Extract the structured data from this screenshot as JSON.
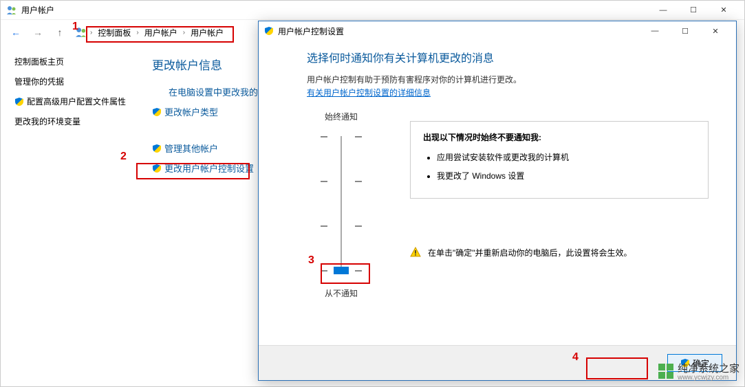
{
  "main_window": {
    "title": "用户帐户",
    "controls": {
      "min": "—",
      "max": "☐",
      "close": "✕"
    },
    "nav": {
      "back": "←",
      "forward": "→",
      "up": "↑"
    },
    "breadcrumb": [
      "控制面板",
      "用户帐户",
      "用户帐户"
    ],
    "sidebar": {
      "home": "控制面板主页",
      "creds": "管理你的凭据",
      "advanced": "配置高级用户配置文件属性",
      "env": "更改我的环境变量"
    },
    "main": {
      "heading": "更改帐户信息",
      "link1": "在电脑设置中更改我的帐户信息",
      "link2": "更改帐户类型",
      "link3": "管理其他帐户",
      "link4": "更改用户帐户控制设置"
    }
  },
  "uac_dialog": {
    "title": "用户帐户控制设置",
    "controls": {
      "min": "—",
      "max": "☐",
      "close": "✕"
    },
    "heading": "选择何时通知你有关计算机更改的消息",
    "subtext": "用户帐户控制有助于预防有害程序对你的计算机进行更改。",
    "link": "有关用户帐户控制设置的详细信息",
    "slider": {
      "top_label": "始终通知",
      "bottom_label": "从不通知"
    },
    "info_box": {
      "title": "出现以下情况时始终不要通知我:",
      "items": [
        "应用尝试安装软件或更改我的计算机",
        "我更改了 Windows 设置"
      ]
    },
    "warning": "在单击\"确定\"并重新启动你的电脑后，此设置将会生效。",
    "buttons": {
      "ok": "确定"
    }
  },
  "annotations": {
    "l1": "1",
    "l2": "2",
    "l3": "3",
    "l4": "4"
  },
  "watermark": {
    "brand": "纯净系统之家",
    "url": "www.ycwjzy.com"
  }
}
